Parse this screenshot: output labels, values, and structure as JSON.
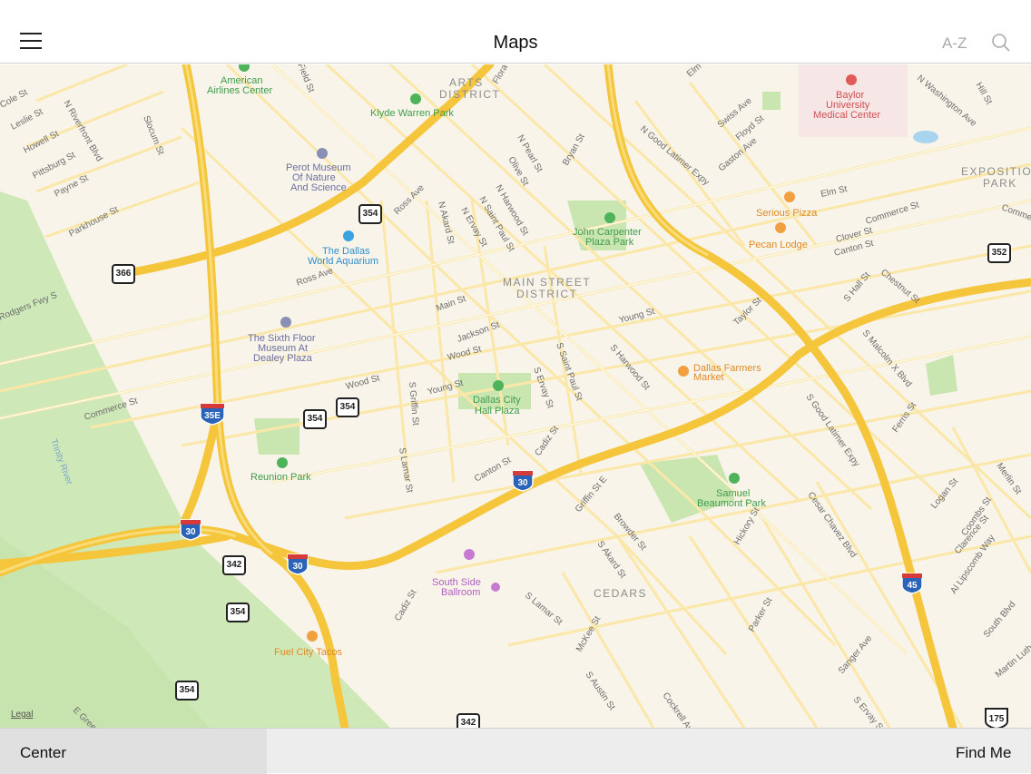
{
  "header": {
    "title": "Maps",
    "az_label": "A-Z"
  },
  "footer": {
    "center_label": "Center",
    "find_me_label": "Find Me"
  },
  "map": {
    "legal": "Legal",
    "districts": [
      "ARTS",
      "DISTRICT",
      "MAIN STREET",
      "DISTRICT",
      "CEDARS",
      "EXPOSITIO",
      "PARK"
    ],
    "pois": [
      {
        "name": "American",
        "name2": "Airlines Center",
        "kind": "park"
      },
      {
        "name": "Klyde Warren Park",
        "kind": "park"
      },
      {
        "name": "Perot Museum",
        "name2": "Of Nature",
        "name3": "And Science",
        "kind": "museum"
      },
      {
        "name": "The Dallas",
        "name2": "World Aquarium",
        "kind": "aquarium"
      },
      {
        "name": "The Sixth Floor",
        "name2": "Museum At",
        "name3": "Dealey Plaza",
        "kind": "museum"
      },
      {
        "name": "Dallas City",
        "name2": "Hall Plaza",
        "kind": "park"
      },
      {
        "name": "Reunion Park",
        "kind": "park"
      },
      {
        "name": "John Carpenter",
        "name2": "Plaza Park",
        "kind": "park"
      },
      {
        "name": "Baylor",
        "name2": "University",
        "name3": "Medical Center",
        "kind": "hospital"
      },
      {
        "name": "Serious Pizza",
        "kind": "food"
      },
      {
        "name": "Pecan Lodge",
        "kind": "food"
      },
      {
        "name": "Dallas Farmers",
        "name2": "Market",
        "kind": "food"
      },
      {
        "name": "Samuel",
        "name2": "Beaumont Park",
        "kind": "park"
      },
      {
        "name": "South Side",
        "name2": "Ballroom",
        "kind": "venue"
      },
      {
        "name": "Fuel City Tacos",
        "kind": "food"
      }
    ],
    "streets": [
      "Cole St",
      "Leslie St",
      "Howell St",
      "Pittsburg St",
      "Payne St",
      "Parkhouse St",
      "N Riverfront Blvd",
      "Slocum St",
      "Field St",
      "Flora St",
      "N Pearl St",
      "Olive St",
      "Bryan St",
      "N Harwood St",
      "N Saint Paul St",
      "N Ervay St",
      "N Akard St",
      "Ross Ave",
      "Ross Ave",
      "Main St",
      "Jackson St",
      "Wood St",
      "Wood St",
      "Young St",
      "Young St",
      "Commerce St",
      "Rodgers Fwy S",
      "S Griffin St",
      "S Lamar St",
      "S Ervay St",
      "S Saint Paul St",
      "S Harwood St",
      "Canton St",
      "Cadiz St",
      "Griffin St E",
      "Browder St",
      "S Akard St",
      "S Lamar St",
      "Cadiz St",
      "McKee St",
      "S Austin St",
      "Cockrell Ave",
      "Hickory St",
      "Parker St",
      "Swiss Ave",
      "Floyd St",
      "Gaston Ave",
      "N Good Latimer Expy",
      "Elm St",
      "Commerce St",
      "Clover St",
      "Canton St",
      "S Hall St",
      "Chestnut St",
      "Taylor St",
      "S Malcolm X Blvd",
      "S Good Latimer Expy",
      "Ferris St",
      "Cesar Chavez Blvd",
      "Logan St",
      "Coombs St",
      "Clarence St",
      "Al Lipscomb Way",
      "Merlin St",
      "South Blvd",
      "Martin Luth",
      "Sanger Ave",
      "S Ervay St",
      "N Washington Ave",
      "Hill St",
      "Elm St",
      "E Greenbr",
      "Commer",
      "Trinity River"
    ],
    "shields": [
      "354",
      "366",
      "35E",
      "354",
      "354",
      "30",
      "30",
      "30",
      "342",
      "354",
      "354",
      "342",
      "30",
      "45",
      "352",
      "175"
    ]
  }
}
